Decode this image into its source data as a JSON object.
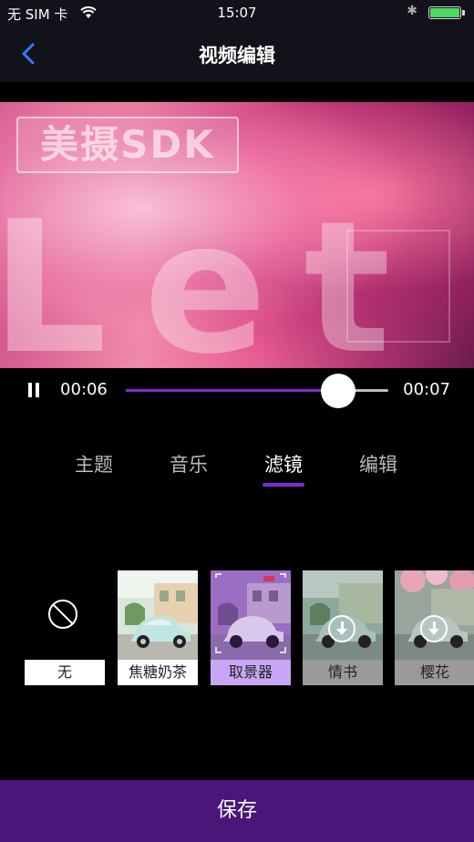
{
  "status_bar": {
    "carrier": "无 SIM 卡",
    "wifi_icon": "wifi-icon",
    "time": "15:07",
    "bluetooth_icon": "bluetooth-icon",
    "battery_icon": "battery-icon",
    "battery_level": 1.0
  },
  "nav": {
    "back_icon": "chevron-left-icon",
    "title": "视频编辑"
  },
  "video": {
    "watermark": "美摄SDK",
    "overlay_text": "Let"
  },
  "player": {
    "pause_icon": "pause-icon",
    "current_time": "00:06",
    "total_time": "00:07",
    "progress": 0.81
  },
  "tabs": [
    {
      "label": "主题",
      "active": false
    },
    {
      "label": "音乐",
      "active": false
    },
    {
      "label": "滤镜",
      "active": true
    },
    {
      "label": "编辑",
      "active": false
    }
  ],
  "filters": [
    {
      "label": "无",
      "icon": "none-icon",
      "selected": false,
      "downloaded": true
    },
    {
      "label": "焦糖奶茶",
      "selected": false,
      "downloaded": true
    },
    {
      "label": "取景器",
      "selected": true,
      "downloaded": true
    },
    {
      "label": "情书",
      "icon": "download-icon",
      "selected": false,
      "downloaded": false
    },
    {
      "label": "樱花",
      "icon": "download-icon",
      "selected": false,
      "downloaded": false
    }
  ],
  "save_button": {
    "label": "保存"
  },
  "colors": {
    "accent": "#7f2bd6",
    "save_bar": "#4a167a",
    "selected_filter": "#c9a6f5",
    "battery": "#4cd964"
  }
}
